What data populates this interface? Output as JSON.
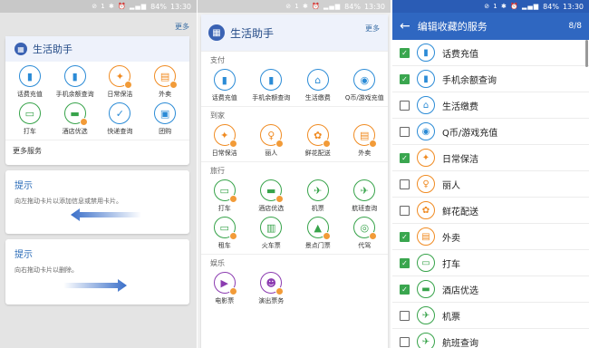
{
  "status": {
    "battery": "84%",
    "time": "13:30",
    "icons": "⊘ 1 ✱ ⏰ ▂▄▆"
  },
  "panelA": {
    "more": "更多",
    "card_title": "生活助手",
    "items": [
      {
        "label": "话费充值",
        "icon": "phone-bill-icon",
        "color": "blue",
        "glyph": "▮"
      },
      {
        "label": "手机余额查询",
        "icon": "balance-query-icon",
        "color": "blue",
        "glyph": "▮"
      },
      {
        "label": "日常保洁",
        "icon": "broom-icon",
        "color": "orange",
        "glyph": "✦"
      },
      {
        "label": "外卖",
        "icon": "takeout-icon",
        "color": "orange",
        "glyph": "▤"
      },
      {
        "label": "打车",
        "icon": "taxi-icon",
        "color": "green",
        "glyph": "▭"
      },
      {
        "label": "酒店优选",
        "icon": "hotel-icon",
        "color": "green",
        "glyph": "▬"
      },
      {
        "label": "快递查询",
        "icon": "express-icon",
        "color": "teal",
        "glyph": "✓"
      },
      {
        "label": "团购",
        "icon": "groupbuy-icon",
        "color": "teal",
        "glyph": "▣"
      }
    ],
    "more_services": "更多服务",
    "tip1": {
      "title": "提示",
      "text": "向左拖动卡片以添加信息或禁用卡片。"
    },
    "tip2": {
      "title": "提示",
      "text": "向右拖动卡片以删除。"
    }
  },
  "panelB": {
    "more": "更多",
    "card_title": "生活助手",
    "sections": [
      {
        "label": "支付",
        "items": [
          {
            "label": "话费充值",
            "icon": "phone-bill-icon",
            "color": "blue",
            "glyph": "▮"
          },
          {
            "label": "手机余额查询",
            "icon": "balance-query-icon",
            "color": "blue",
            "glyph": "▮"
          },
          {
            "label": "生活缴费",
            "icon": "house-icon",
            "color": "blue",
            "glyph": "⌂"
          },
          {
            "label": "Q币/游戏充值",
            "icon": "gamepad-icon",
            "color": "blue",
            "glyph": "◉"
          }
        ]
      },
      {
        "label": "到家",
        "items": [
          {
            "label": "日常保洁",
            "icon": "broom-icon",
            "color": "orange",
            "glyph": "✦"
          },
          {
            "label": "丽人",
            "icon": "beauty-icon",
            "color": "orange",
            "glyph": "♀"
          },
          {
            "label": "鲜花配送",
            "icon": "flower-icon",
            "color": "orange",
            "glyph": "✿"
          },
          {
            "label": "外卖",
            "icon": "takeout-icon",
            "color": "orange",
            "glyph": "▤"
          }
        ]
      },
      {
        "label": "旅行",
        "items": [
          {
            "label": "打车",
            "icon": "taxi-icon",
            "color": "green",
            "glyph": "▭"
          },
          {
            "label": "酒店优选",
            "icon": "hotel-icon",
            "color": "green",
            "glyph": "▬"
          },
          {
            "label": "机票",
            "icon": "ticket-icon",
            "color": "green",
            "glyph": "✈"
          },
          {
            "label": "航班查询",
            "icon": "plane-icon",
            "color": "green",
            "glyph": "✈"
          },
          {
            "label": "租车",
            "icon": "rental-car-icon",
            "color": "green",
            "glyph": "▭"
          },
          {
            "label": "火车票",
            "icon": "train-icon",
            "color": "green",
            "glyph": "▥"
          },
          {
            "label": "景点门票",
            "icon": "scenic-ticket-icon",
            "color": "green",
            "glyph": "▲"
          },
          {
            "label": "代驾",
            "icon": "driver-icon",
            "color": "green",
            "glyph": "◎"
          }
        ]
      },
      {
        "label": "娱乐",
        "items": [
          {
            "label": "电影票",
            "icon": "movie-icon",
            "color": "purple",
            "glyph": "▶"
          },
          {
            "label": "演出票务",
            "icon": "show-icon",
            "color": "purple",
            "glyph": "☻"
          }
        ]
      }
    ]
  },
  "panelC": {
    "title": "编辑收藏的服务",
    "count": "8/8",
    "rows": [
      {
        "label": "话费充值",
        "checked": true,
        "icon": "phone-bill-icon",
        "color": "blue",
        "glyph": "▮"
      },
      {
        "label": "手机余额查询",
        "checked": true,
        "icon": "balance-query-icon",
        "color": "blue",
        "glyph": "▮"
      },
      {
        "label": "生活缴费",
        "checked": false,
        "icon": "house-icon",
        "color": "blue",
        "glyph": "⌂"
      },
      {
        "label": "Q币/游戏充值",
        "checked": false,
        "icon": "gamepad-icon",
        "color": "blue",
        "glyph": "◉"
      },
      {
        "label": "日常保洁",
        "checked": true,
        "icon": "broom-icon",
        "color": "orange",
        "glyph": "✦"
      },
      {
        "label": "丽人",
        "checked": false,
        "icon": "beauty-icon",
        "color": "orange",
        "glyph": "♀"
      },
      {
        "label": "鲜花配送",
        "checked": false,
        "icon": "flower-icon",
        "color": "orange",
        "glyph": "✿"
      },
      {
        "label": "外卖",
        "checked": true,
        "icon": "takeout-icon",
        "color": "orange",
        "glyph": "▤"
      },
      {
        "label": "打车",
        "checked": true,
        "icon": "taxi-icon",
        "color": "green",
        "glyph": "▭"
      },
      {
        "label": "酒店优选",
        "checked": true,
        "icon": "hotel-icon",
        "color": "green",
        "glyph": "▬"
      },
      {
        "label": "机票",
        "checked": false,
        "icon": "ticket-icon",
        "color": "green",
        "glyph": "✈"
      },
      {
        "label": "航班查询",
        "checked": false,
        "icon": "plane-icon",
        "color": "green",
        "glyph": "✈"
      }
    ]
  }
}
